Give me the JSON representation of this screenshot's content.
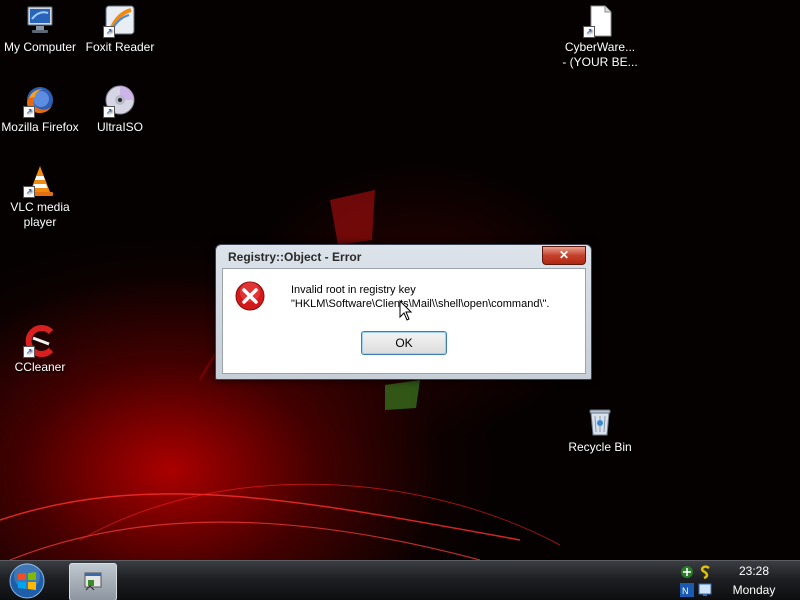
{
  "desktop": {
    "icons": [
      {
        "id": "my-computer",
        "label": "My Computer",
        "icon": "computer-icon"
      },
      {
        "id": "foxit-reader",
        "label": "Foxit Reader",
        "icon": "foxit-reader-icon"
      },
      {
        "id": "cyberware",
        "label": "CyberWare...\n- (YOUR BE...",
        "icon": "document-icon"
      },
      {
        "id": "firefox",
        "label": "Mozilla Firefox",
        "icon": "firefox-icon"
      },
      {
        "id": "ultraiso",
        "label": "UltraISO",
        "icon": "ultraiso-disc-icon"
      },
      {
        "id": "vlc",
        "label": "VLC media\nplayer",
        "icon": "vlc-cone-icon"
      },
      {
        "id": "ccleaner",
        "label": "CCleaner",
        "icon": "ccleaner-icon"
      },
      {
        "id": "recycle-bin",
        "label": "Recycle Bin",
        "icon": "recycle-bin-icon"
      }
    ]
  },
  "dialog": {
    "title": "Registry::Object - Error",
    "close_label": "✕",
    "message_line1": "Invalid root in registry key",
    "message_line2": "\"HKLM\\Software\\Clients\\Mail\\\\shell\\open\\command\\\".",
    "ok_label": "OK"
  },
  "taskbar": {
    "time": "23:28",
    "day": "Monday"
  },
  "colors": {
    "close_button": "#c4402a",
    "error_icon": "#d21a1a",
    "ok_border": "#3c7fb1"
  }
}
